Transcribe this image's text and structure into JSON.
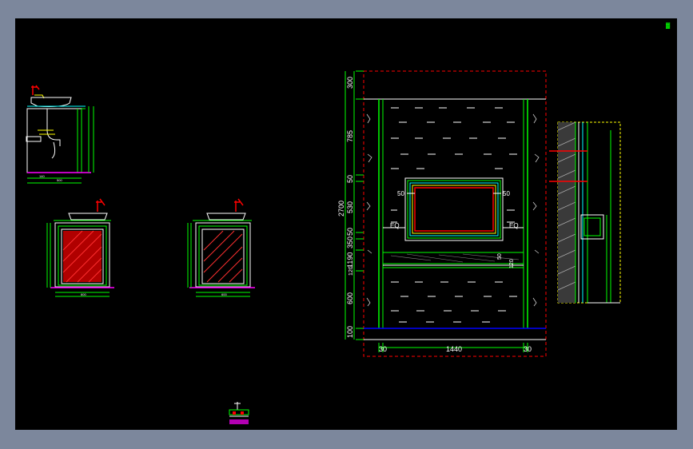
{
  "main_elevation": {
    "left_dims": [
      "300",
      "785",
      "50",
      "530",
      "50",
      "350",
      "1190",
      "120",
      "600",
      "100"
    ],
    "total_height": "2700",
    "bottom_dims": [
      "30",
      "1440",
      "30"
    ],
    "frame_label_left": "50",
    "frame_label_right": "50",
    "eq_left": "EQ",
    "eq_right": "EQ",
    "shelf_dim_1": "50",
    "shelf_dim_2": "120"
  },
  "colors": {
    "background": "#000000",
    "border": "#7c879c",
    "green": "#00ff00",
    "yellow": "#ffff00",
    "red": "#ff0000",
    "cyan": "#00ffff",
    "magenta": "#ff00ff",
    "white": "#ffffff",
    "blue": "#0000ff"
  }
}
